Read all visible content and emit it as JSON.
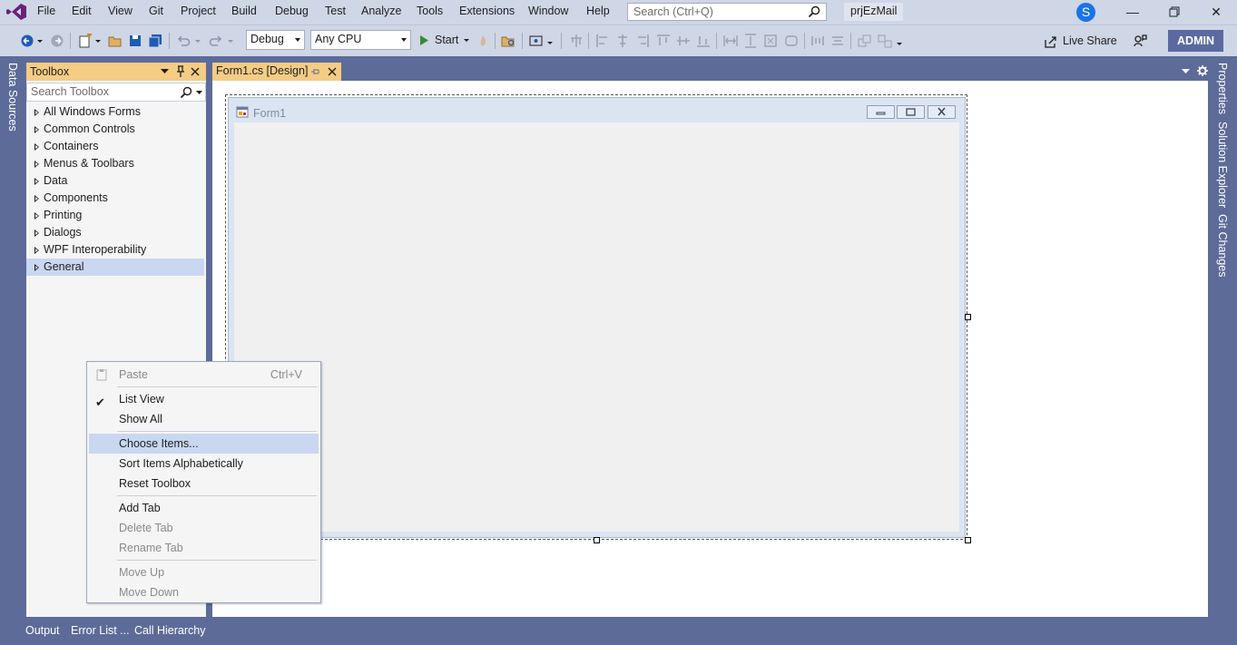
{
  "menu": {
    "items": [
      "File",
      "Edit",
      "View",
      "Git",
      "Project",
      "Build",
      "Debug",
      "Test",
      "Analyze",
      "Tools",
      "Extensions",
      "Window",
      "Help"
    ],
    "search_placeholder": "Search (Ctrl+Q)",
    "project_name": "prjEzMail",
    "avatar_letter": "S"
  },
  "toolbar": {
    "config": "Debug",
    "platform": "Any CPU",
    "start_label": "Start",
    "live_share": "Live Share",
    "admin": "ADMIN"
  },
  "left_rail": {
    "data_sources": "Data Sources"
  },
  "toolbox": {
    "title": "Toolbox",
    "search_placeholder": "Search Toolbox",
    "items": [
      "All Windows Forms",
      "Common Controls",
      "Containers",
      "Menus & Toolbars",
      "Data",
      "Components",
      "Printing",
      "Dialogs",
      "WPF Interoperability",
      "General"
    ],
    "selected": "General"
  },
  "document": {
    "tab_label": "Form1.cs [Design]",
    "form_title": "Form1"
  },
  "right_rail": {
    "properties": "Properties",
    "solution_explorer": "Solution Explorer",
    "git_changes": "Git Changes"
  },
  "bottom": {
    "items": [
      "Output",
      "Error List ...",
      "Call Hierarchy"
    ]
  },
  "context_menu": {
    "paste": "Paste",
    "paste_shortcut": "Ctrl+V",
    "list_view": "List View",
    "show_all": "Show All",
    "choose_items": "Choose Items...",
    "sort_items": "Sort Items Alphabetically",
    "reset_toolbox": "Reset Toolbox",
    "add_tab": "Add Tab",
    "delete_tab": "Delete Tab",
    "rename_tab": "Rename Tab",
    "move_up": "Move Up",
    "move_down": "Move Down"
  },
  "colors": {
    "chrome": "#cfd6e5",
    "frame": "#5d6b99",
    "active_tab": "#f5cc84",
    "highlight": "#c9d7f1",
    "admin": "#5a6aa0"
  }
}
